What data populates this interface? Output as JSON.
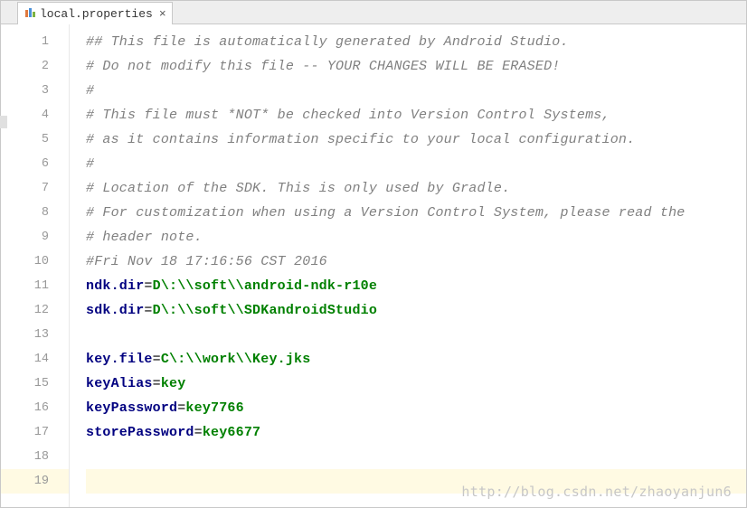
{
  "tab": {
    "filename": "local.properties",
    "close_glyph": "×"
  },
  "lines": [
    {
      "n": 1,
      "type": "comment",
      "text": "## This file is automatically generated by Android Studio."
    },
    {
      "n": 2,
      "type": "comment",
      "text": "# Do not modify this file -- YOUR CHANGES WILL BE ERASED!"
    },
    {
      "n": 3,
      "type": "comment",
      "text": "#"
    },
    {
      "n": 4,
      "type": "comment",
      "text": "# This file must *NOT* be checked into Version Control Systems,"
    },
    {
      "n": 5,
      "type": "comment",
      "text": "# as it contains information specific to your local configuration."
    },
    {
      "n": 6,
      "type": "comment",
      "text": "#"
    },
    {
      "n": 7,
      "type": "comment",
      "text": "# Location of the SDK. This is only used by Gradle."
    },
    {
      "n": 8,
      "type": "comment",
      "text": "# For customization when using a Version Control System, please read the"
    },
    {
      "n": 9,
      "type": "comment",
      "text": "# header note."
    },
    {
      "n": 10,
      "type": "comment",
      "text": "#Fri Nov 18 17:16:56 CST 2016"
    },
    {
      "n": 11,
      "type": "kv",
      "key": "ndk.dir",
      "value": "D\\:\\\\soft\\\\android-ndk-r10e"
    },
    {
      "n": 12,
      "type": "kv",
      "key": "sdk.dir",
      "value": "D\\:\\\\soft\\\\SDKandroidStudio"
    },
    {
      "n": 13,
      "type": "blank"
    },
    {
      "n": 14,
      "type": "kv",
      "key": "key.file",
      "value": "C\\:\\\\work\\\\Key.jks"
    },
    {
      "n": 15,
      "type": "kv",
      "key": "keyAlias",
      "value": "key"
    },
    {
      "n": 16,
      "type": "kv",
      "key": "keyPassword",
      "value": "key7766"
    },
    {
      "n": 17,
      "type": "kv",
      "key": "storePassword",
      "value": "key6677"
    },
    {
      "n": 18,
      "type": "blank"
    },
    {
      "n": 19,
      "type": "blank",
      "current": true
    }
  ],
  "watermark": "http://blog.csdn.net/zhaoyanjun6"
}
